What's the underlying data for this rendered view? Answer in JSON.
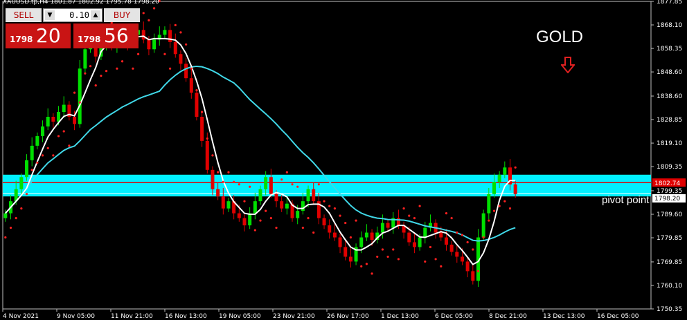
{
  "header": {
    "symbol_line": "XAUUSD.tp,H4   1801.87 1802.92 1795.78 1798.20"
  },
  "trade_panel": {
    "sell_label": "SELL",
    "buy_label": "BUY",
    "lot": "0.10",
    "sell_small": "1798",
    "sell_big": "20",
    "buy_small": "1798",
    "buy_big": "56"
  },
  "annotations": {
    "title": "GOLD",
    "pivot": "pivot point"
  },
  "chart_data": {
    "type": "candlestick",
    "ylim": [
      1750.35,
      1877.85
    ],
    "y_ticks": [
      "1877.85",
      "1868.10",
      "1858.35",
      "1848.60",
      "1838.60",
      "1828.85",
      "1819.10",
      "1809.35",
      "1799.35",
      "1789.60",
      "1779.85",
      "1769.85",
      "1760.10",
      "1750.35"
    ],
    "x_ticks": [
      "4 Nov 2021",
      "9 Nov 05:00",
      "11 Nov 21:00",
      "16 Nov 13:00",
      "19 Nov 05:00",
      "23 Nov 21:00",
      "26 Nov 17:00",
      "1 Dec 13:00",
      "6 Dec 05:00",
      "8 Dec 21:00",
      "13 Dec 13:00",
      "16 Dec 05:00"
    ],
    "current_price": "1798.20",
    "bid_label": "1802.74",
    "pivot_zone": [
      1797.0,
      1806.0
    ],
    "pivot_line": 1802.74,
    "pivot_level": 1798.2,
    "colors": {
      "up": "#00e000",
      "down": "#e00000",
      "zone": "#00f0ff",
      "slow_ma": "#40d8e8",
      "fast_ma": "#ffffff",
      "sar": "#ff2020"
    },
    "close": [
      1790,
      1795,
      1800,
      1805,
      1812,
      1818,
      1822,
      1826,
      1830,
      1828,
      1832,
      1835,
      1830,
      1827,
      1850,
      1858,
      1862,
      1855,
      1860,
      1863,
      1859,
      1861,
      1865,
      1860,
      1864,
      1866,
      1862,
      1858,
      1862,
      1864,
      1866,
      1861,
      1856,
      1852,
      1846,
      1840,
      1830,
      1820,
      1808,
      1800,
      1797,
      1792,
      1795,
      1790,
      1788,
      1785,
      1790,
      1795,
      1800,
      1805,
      1798,
      1795,
      1792,
      1794,
      1788,
      1791,
      1795,
      1800,
      1795,
      1788,
      1785,
      1782,
      1780,
      1776,
      1772,
      1770,
      1776,
      1780,
      1782,
      1779,
      1782,
      1786,
      1784,
      1788,
      1785,
      1782,
      1778,
      1776,
      1780,
      1784,
      1786,
      1782,
      1780,
      1777,
      1774,
      1772,
      1770,
      1766,
      1762,
      1780,
      1790,
      1798,
      1803,
      1806,
      1809,
      1802,
      1798
    ]
  }
}
